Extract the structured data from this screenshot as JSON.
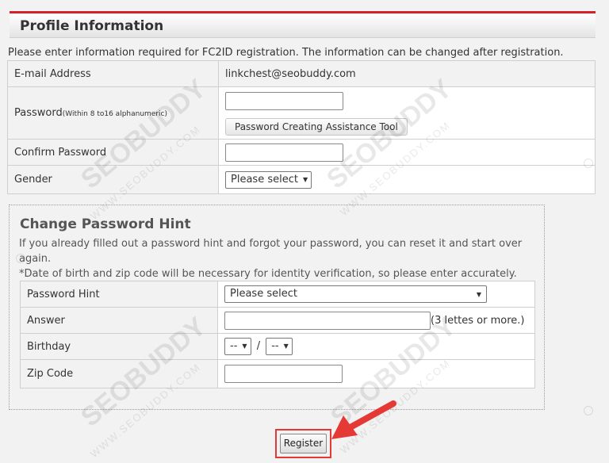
{
  "section": {
    "title": "Profile Information"
  },
  "intro": "Please enter information required for FC2ID registration. The information can be changed after registration.",
  "profile": {
    "email_label": "E-mail Address",
    "email_value": "linkchest@seobuddy.com",
    "password_label": "Password",
    "password_note": "(Within 8 to16 alphanumeric)",
    "password_tool_button": "Password Creating Assistance Tool",
    "confirm_label": "Confirm Password",
    "gender_label": "Gender",
    "gender_selected": "Please select"
  },
  "hint": {
    "title": "Change Password Hint",
    "text1": "If you already filled out a password hint and forgot your password, you can reset it and start over again.",
    "text2": "*Date of birth and zip code will be necessary for identity verification, so please enter accurately.",
    "hint_label": "Password Hint",
    "hint_selected": "Please select",
    "answer_label": "Answer",
    "answer_note": "(3 lettes or more.)",
    "birthday_label": "Birthday",
    "birthday_month": "--",
    "birthday_separator": "/",
    "birthday_day": "--",
    "zip_label": "Zip Code"
  },
  "register_button": "Register",
  "watermark": {
    "brand": "SEOBUDDY",
    "site": "WWW.SEOBUDDY.COM"
  },
  "colors": {
    "accent_red": "#d9202a",
    "highlight_red": "#e53935"
  }
}
